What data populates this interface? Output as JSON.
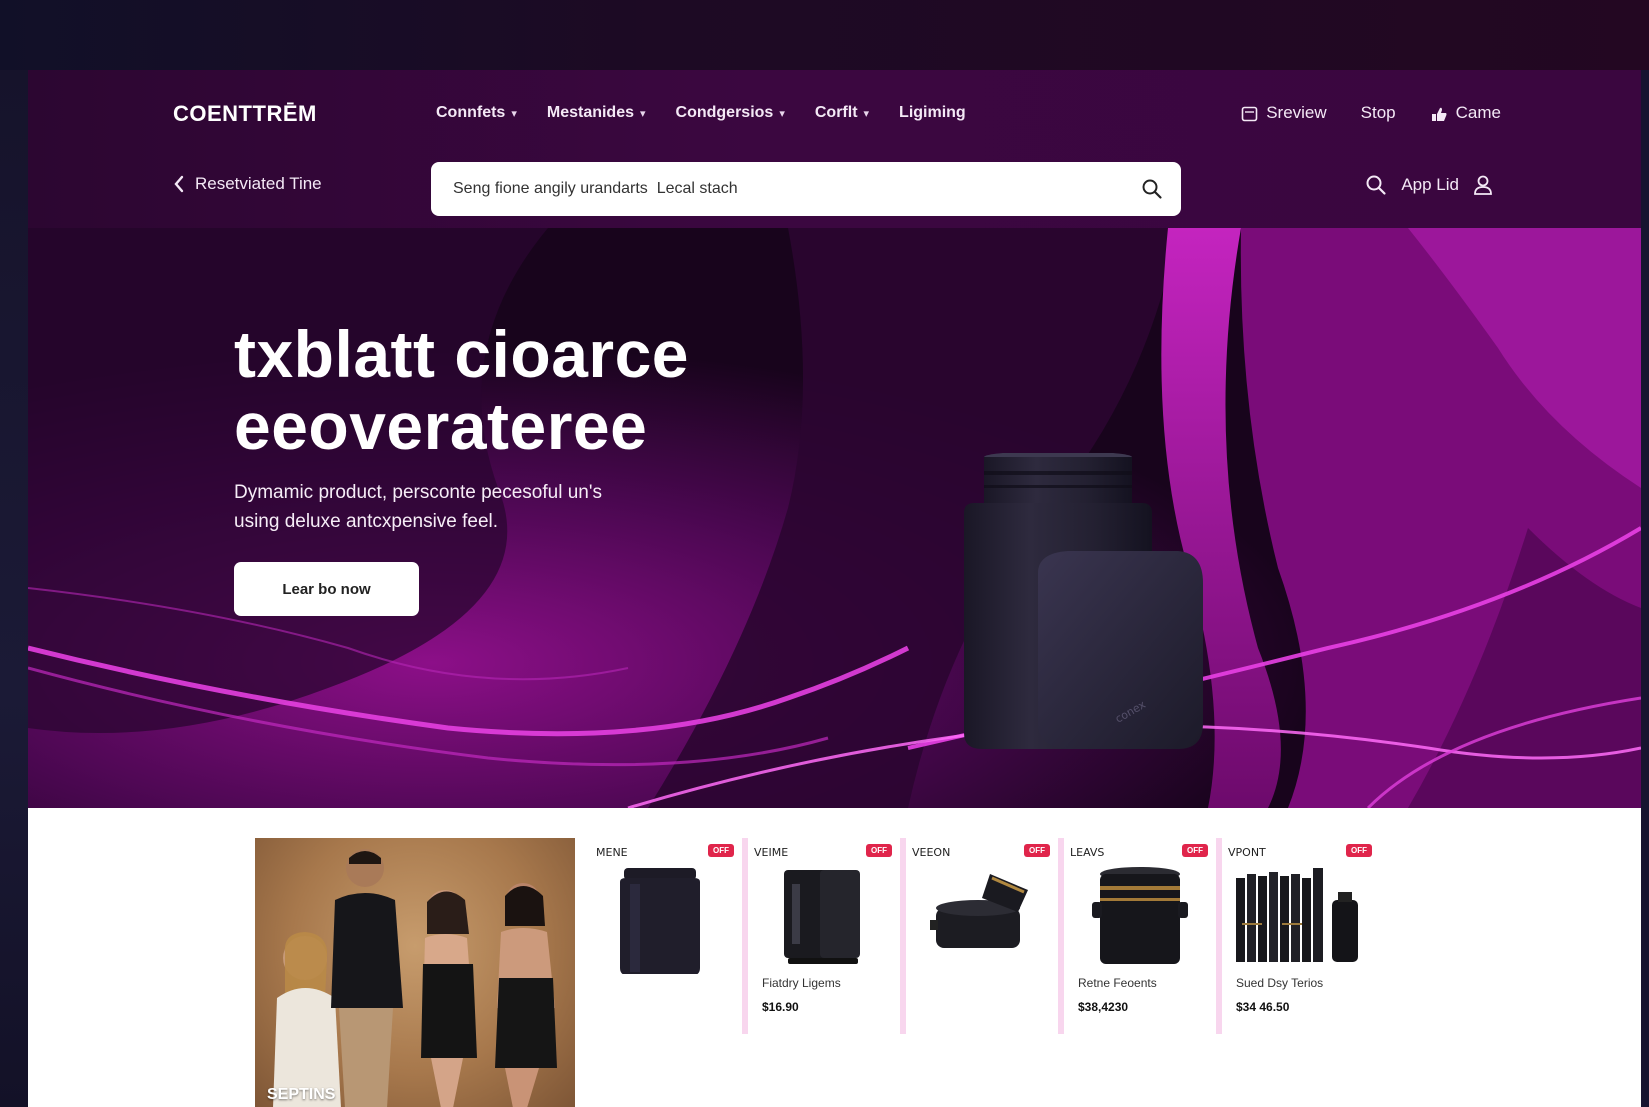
{
  "brand": {
    "logo": "COENTTRĒM"
  },
  "nav": {
    "items": [
      {
        "label": "Connfets",
        "has_dropdown": true
      },
      {
        "label": "Mestanides",
        "has_dropdown": true
      },
      {
        "label": "Condgersios",
        "has_dropdown": true
      },
      {
        "label": "Corflt",
        "has_dropdown": true
      },
      {
        "label": "Ligiming",
        "has_dropdown": false
      }
    ],
    "right": [
      {
        "label": "Sreview",
        "icon": "calendar-icon"
      },
      {
        "label": "Stop",
        "icon": ""
      },
      {
        "label": "Came",
        "icon": "hand-icon"
      }
    ]
  },
  "subheader": {
    "back_label": "Resetviated Tine",
    "search_value": "Seng fione angily urandarts  Lecal stach",
    "tools_label": "App Lid"
  },
  "hero": {
    "title_line1": "txblatt cioarce",
    "title_line2": "eeoverateree",
    "subtitle_line1": "Dymamic product, persconte pecesoful un's",
    "subtitle_line2": "using deluxe antcxpensive feel.",
    "cta_label": "Lear bo now",
    "product_mark": "conex"
  },
  "promo": {
    "label": "SEPTINS"
  },
  "products": [
    {
      "brand": "MENE",
      "badge": "OFF",
      "name": "",
      "price": ""
    },
    {
      "brand": "VEIME",
      "badge": "OFF",
      "name": "Fiatdry Ligems",
      "price": "$16.90"
    },
    {
      "brand": "VEEON",
      "badge": "OFF",
      "name": "",
      "price": ""
    },
    {
      "brand": "LEAVS",
      "badge": "OFF",
      "name": "Retne Feoents",
      "price": "$38,4230"
    },
    {
      "brand": "VPONT",
      "badge": "OFF",
      "name": "Sued Dsy Terios",
      "price": "$34 46.50"
    }
  ],
  "colors": {
    "header": "#3b0740",
    "accent": "#d21fc7",
    "badge": "#e0254b"
  }
}
